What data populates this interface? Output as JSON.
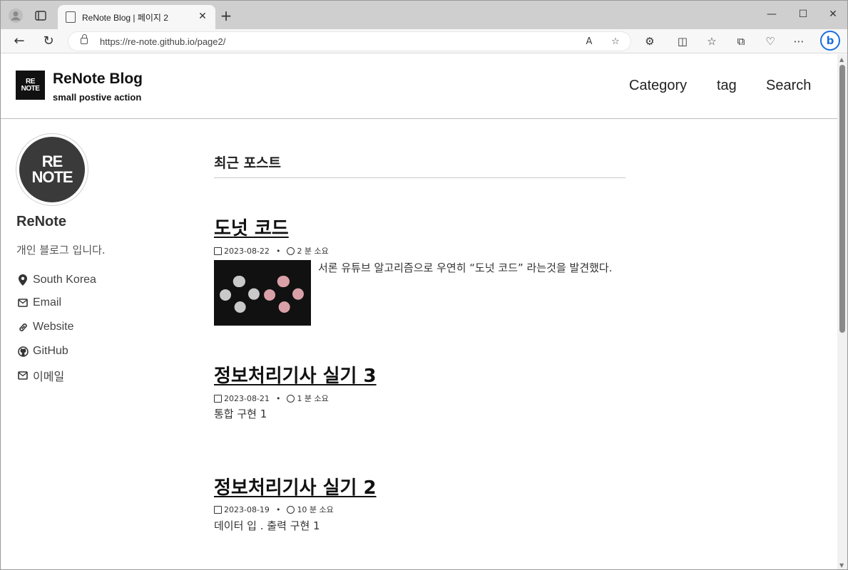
{
  "browser": {
    "tab_title": "ReNote Blog | 페이지 2",
    "url": "https://re-note.github.io/page2/"
  },
  "site": {
    "logo_line1": "RE",
    "logo_line2": "NOTE",
    "title": "ReNote Blog",
    "subtitle": "small postive action",
    "nav": [
      "Category",
      "tag",
      "Search"
    ]
  },
  "author": {
    "avatar_line1": "RE",
    "avatar_line2": "NOTE",
    "name": "ReNote",
    "bio": "개인 블로그 입니다.",
    "links": [
      {
        "icon": "map-marker-icon",
        "label": "South Korea"
      },
      {
        "icon": "envelope-icon",
        "label": "Email"
      },
      {
        "icon": "link-icon",
        "label": "Website"
      },
      {
        "icon": "github-icon",
        "label": "GitHub"
      },
      {
        "icon": "envelope-icon",
        "label": "이메일"
      }
    ]
  },
  "main": {
    "section_title": "최근 포스트",
    "posts": [
      {
        "title": "도넛 코드",
        "date": "2023-08-22",
        "read_time": "2 분 소요",
        "excerpt": "서론 유튜브 알고리즘으로 우연히 “도넛 코드” 라는것을 발견했다."
      },
      {
        "title": "정보처리기사 실기 3",
        "date": "2023-08-21",
        "read_time": "1 분 소요",
        "excerpt": "통합 구현 1"
      },
      {
        "title": "정보처리기사 실기 2",
        "date": "2023-08-19",
        "read_time": "10 분 소요",
        "excerpt": "데이터 입 . 출력 구현 1"
      }
    ]
  }
}
